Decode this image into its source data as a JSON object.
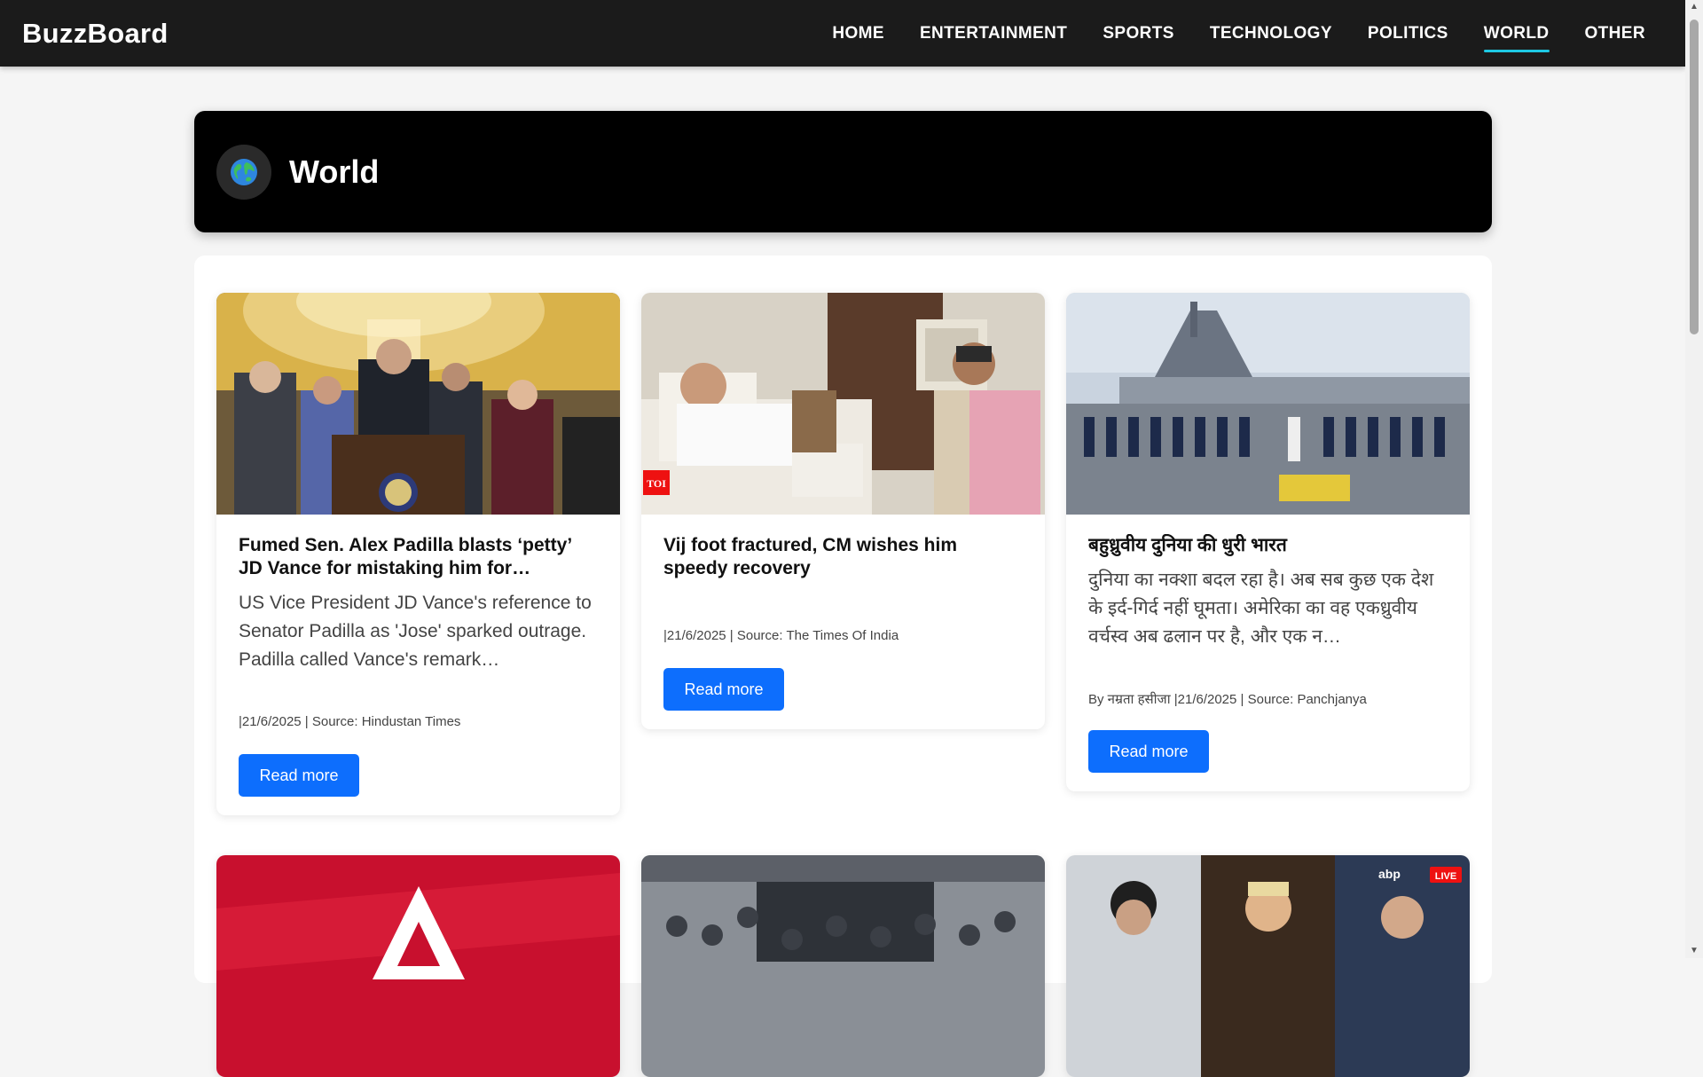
{
  "brand": "BuzzBoard",
  "nav": {
    "items": [
      "HOME",
      "ENTERTAINMENT",
      "SPORTS",
      "TECHNOLOGY",
      "POLITICS",
      "WORLD",
      "OTHER"
    ],
    "active": "WORLD",
    "accent_color": "#1ec8e3"
  },
  "category": {
    "title": "World",
    "icon": "globe-icon"
  },
  "articles": [
    {
      "title": "Fumed Sen. Alex Padilla blasts ‘petty’ JD Vance for mistaking him for…",
      "description": "US Vice President JD Vance's reference to Senator Padilla as 'Jose' sparked outrage. Padilla called Vance's remark…",
      "meta": "|21/6/2025 | Source: Hindustan Times",
      "button": "Read more"
    },
    {
      "title": "Vij foot fractured, CM wishes him speedy recovery",
      "description": "",
      "meta": "|21/6/2025 | Source: The Times Of India",
      "button": "Read more",
      "image_badge": "TOI"
    },
    {
      "title": "बहुध्रुवीय दुनिया की धुरी भारत",
      "description": "दुनिया का नक्शा बदल रहा है। अब सब कुछ एक देश के इर्द-गिर्द नहीं घूमता। अमेरिका का वह एकध्रुवीय वर्चस्व अब ढलान पर है, और एक न…",
      "meta": "By नम्रता हसीजा |21/6/2025 | Source: Panchjanya",
      "button": "Read more"
    }
  ],
  "row2": [
    {
      "image": "red-logo-image"
    },
    {
      "image": "crowd-image"
    },
    {
      "image": "leaders-image",
      "badge_logo": "abp",
      "badge_live": "LIVE"
    }
  ],
  "colors": {
    "navbar": "#1b1b1b",
    "button": "#0d6efd",
    "banner": "#000000"
  }
}
